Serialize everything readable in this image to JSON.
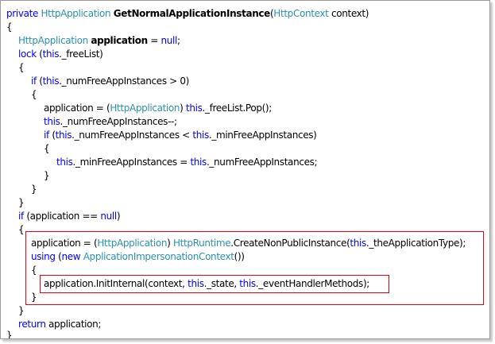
{
  "code": {
    "lines": [
      [
        {
          "c": "kw",
          "t": "private "
        },
        {
          "c": "ty",
          "t": "HttpApplication "
        },
        {
          "c": "fn",
          "t": "GetNormalApplicationInstance"
        },
        {
          "c": "pl",
          "t": "("
        },
        {
          "c": "ty",
          "t": "HttpContext"
        },
        {
          "c": "pl",
          "t": " context)"
        }
      ],
      [
        {
          "c": "pl",
          "t": "{"
        }
      ],
      [
        {
          "c": "ty",
          "t": "HttpApplication "
        },
        {
          "c": "fn",
          "t": "application"
        },
        {
          "c": "pl",
          "t": " = "
        },
        {
          "c": "kw",
          "t": "null"
        },
        {
          "c": "pl",
          "t": ";"
        }
      ],
      [
        {
          "c": "kw",
          "t": "lock"
        },
        {
          "c": "pl",
          "t": " ("
        },
        {
          "c": "kw",
          "t": "this"
        },
        {
          "c": "pl",
          "t": "._freeList)"
        }
      ],
      [
        {
          "c": "pl",
          "t": "{"
        }
      ],
      [
        {
          "c": "kw",
          "t": "if"
        },
        {
          "c": "pl",
          "t": " ("
        },
        {
          "c": "kw",
          "t": "this"
        },
        {
          "c": "pl",
          "t": "._numFreeAppInstances > 0)"
        }
      ],
      [
        {
          "c": "pl",
          "t": "{"
        }
      ],
      [
        {
          "c": "pl",
          "t": "application = ("
        },
        {
          "c": "ty",
          "t": "HttpApplication"
        },
        {
          "c": "pl",
          "t": ") "
        },
        {
          "c": "kw",
          "t": "this"
        },
        {
          "c": "pl",
          "t": "._freeList.Pop();"
        }
      ],
      [
        {
          "c": "kw",
          "t": "this"
        },
        {
          "c": "pl",
          "t": "._numFreeAppInstances--;"
        }
      ],
      [
        {
          "c": "kw",
          "t": "if"
        },
        {
          "c": "pl",
          "t": " ("
        },
        {
          "c": "kw",
          "t": "this"
        },
        {
          "c": "pl",
          "t": "._numFreeAppInstances < "
        },
        {
          "c": "kw",
          "t": "this"
        },
        {
          "c": "pl",
          "t": "._minFreeAppInstances)"
        }
      ],
      [
        {
          "c": "pl",
          "t": "{"
        }
      ],
      [
        {
          "c": "kw",
          "t": "this"
        },
        {
          "c": "pl",
          "t": "._minFreeAppInstances = "
        },
        {
          "c": "kw",
          "t": "this"
        },
        {
          "c": "pl",
          "t": "._numFreeAppInstances;"
        }
      ],
      [
        {
          "c": "pl",
          "t": "}"
        }
      ],
      [
        {
          "c": "pl",
          "t": "}"
        }
      ],
      [
        {
          "c": "pl",
          "t": "}"
        }
      ],
      [
        {
          "c": "kw",
          "t": "if"
        },
        {
          "c": "pl",
          "t": " (application == "
        },
        {
          "c": "kw",
          "t": "null"
        },
        {
          "c": "pl",
          "t": ")"
        }
      ],
      [
        {
          "c": "pl",
          "t": "{"
        }
      ],
      [
        {
          "c": "pl",
          "t": "application = ("
        },
        {
          "c": "ty",
          "t": "HttpApplication"
        },
        {
          "c": "pl",
          "t": ") "
        },
        {
          "c": "ty",
          "t": "HttpRuntime"
        },
        {
          "c": "pl",
          "t": ".CreateNonPublicInstance("
        },
        {
          "c": "kw",
          "t": "this"
        },
        {
          "c": "pl",
          "t": "._theApplicationType);"
        }
      ],
      [
        {
          "c": "kw",
          "t": "using"
        },
        {
          "c": "pl",
          "t": " ("
        },
        {
          "c": "kw",
          "t": "new "
        },
        {
          "c": "ty",
          "t": "ApplicationImpersonationContext"
        },
        {
          "c": "pl",
          "t": "())"
        }
      ],
      [
        {
          "c": "pl",
          "t": "{"
        }
      ],
      [
        {
          "c": "pl",
          "t": "application.InitInternal(context, "
        },
        {
          "c": "kw",
          "t": "this"
        },
        {
          "c": "pl",
          "t": "._state, "
        },
        {
          "c": "kw",
          "t": "this"
        },
        {
          "c": "pl",
          "t": "._eventHandlerMethods);"
        }
      ],
      [
        {
          "c": "pl",
          "t": "}"
        }
      ],
      [
        {
          "c": "pl",
          "t": "}"
        }
      ],
      [
        {
          "c": "kw",
          "t": "return"
        },
        {
          "c": "pl",
          "t": " application;"
        }
      ],
      [
        {
          "c": "pl",
          "t": "}"
        }
      ]
    ]
  },
  "colors": {
    "keyword": "#0000ff",
    "type": "#2b91af",
    "plain": "#000000",
    "highlight_border": "#e4000f"
  }
}
